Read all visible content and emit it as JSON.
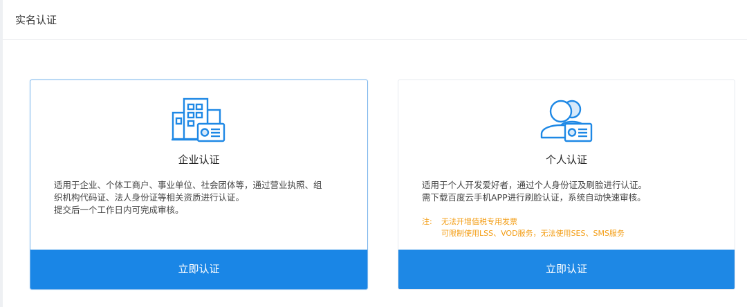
{
  "header": {
    "title": "实名认证"
  },
  "colors": {
    "accent": "#1e88e5",
    "note": "#f39c12"
  },
  "cards": [
    {
      "key": "enterprise",
      "icon": "building-id-card-icon",
      "title": "企业认证",
      "description": [
        "适用于企业、个体工商户、事业单位、社会团体等，通过营业执照、组",
        "织机构代码证、法人身份证等相关资质进行认证。",
        "提交后一个工作日内可完成审核。"
      ],
      "button_label": "立即认证"
    },
    {
      "key": "personal",
      "icon": "users-id-card-icon",
      "title": "个人认证",
      "description": [
        "适用于个人开发爱好者，通过个人身份证及刷脸进行认证。",
        "需下载百度云手机APP进行刷脸认证，系统自动快速审核。"
      ],
      "note": {
        "label": "注:",
        "lines": [
          "无法开增值税专用发票",
          "可限制使用LSS、VOD服务，无法使用SES、SMS服务"
        ]
      },
      "button_label": "立即认证"
    }
  ]
}
